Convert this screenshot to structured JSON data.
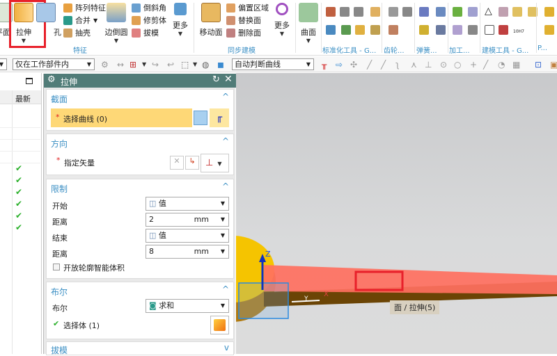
{
  "ribbon": {
    "feature_group": {
      "label": "特征",
      "items": {
        "plane": "平面",
        "extrude": "拉伸",
        "hole": "孔",
        "pattern": "阵列特征",
        "unite": "合并",
        "shell": "抽壳",
        "edge_blend": "边倒圆",
        "chamfer": "倒斜角",
        "trim_body": "修剪体",
        "draft": "拔模",
        "more": "更多"
      }
    },
    "sync_group": {
      "label": "同步建模",
      "items": {
        "move_face": "移动面",
        "offset_region": "偏置区域",
        "replace_face": "替换面",
        "delete_face": "删除面",
        "more": "更多"
      }
    },
    "surface": "曲面",
    "groups": [
      "标准化工具 - G...",
      "齿轮...",
      "弹簧...",
      "加工...",
      "建模工具 - G...",
      "P..."
    ],
    "tolerance_label": "10H7"
  },
  "toolbar": {
    "scope": "仅在工作部件内",
    "curve_rule": "自动判断曲线"
  },
  "navigator": {
    "col_latest": "最新",
    "check": "✔"
  },
  "dialog": {
    "title": "拉伸",
    "section": {
      "title": "截面",
      "select_curve": "选择曲线 (0)"
    },
    "direction": {
      "title": "方向",
      "specify_vector": "指定矢量"
    },
    "limits": {
      "title": "限制",
      "start_label": "开始",
      "start_value": "值",
      "distance_label": "距离",
      "start_distance": "2",
      "unit": "mm",
      "end_label": "结束",
      "end_value": "值",
      "end_distance": "8",
      "open_profile": "开放轮廓智能体积"
    },
    "boolean": {
      "title": "布尔",
      "label": "布尔",
      "value": "求和",
      "select_body": "选择体 (1)"
    },
    "draft": {
      "title": "拔模"
    },
    "required": "*"
  },
  "viewport": {
    "tooltip": "面 / 拉伸(5)",
    "axis_z": "Z",
    "axis_x": "X",
    "axis_y": "Y"
  },
  "colors": {
    "accent": "#3b8fc4",
    "dialog_header": "#517c78",
    "highlight": "#fed877",
    "extrude_preview": "#ff7060",
    "annotation": "#e8202a"
  }
}
